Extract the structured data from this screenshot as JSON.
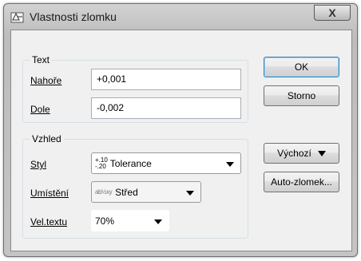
{
  "window": {
    "title": "Vlastnosti zlomku",
    "close_glyph": "X"
  },
  "text_group": {
    "title": "Text",
    "upper_label": "Nahoře",
    "upper_value": "+0,001",
    "lower_label": "Dole",
    "lower_value": "-0,002"
  },
  "appearance_group": {
    "title": "Vzhled",
    "style_label": "Styl",
    "style_value": "Tolerance",
    "style_icon_top": "+.10",
    "style_icon_bottom": "-.20",
    "position_label": "Umístění",
    "position_value": "Střed",
    "position_icon": "ab½xy",
    "size_label": "Vel.textu",
    "size_value": "70%"
  },
  "buttons": {
    "ok": "OK",
    "cancel": "Storno",
    "default": "Výchozí",
    "auto": "Auto-zlomek..."
  }
}
